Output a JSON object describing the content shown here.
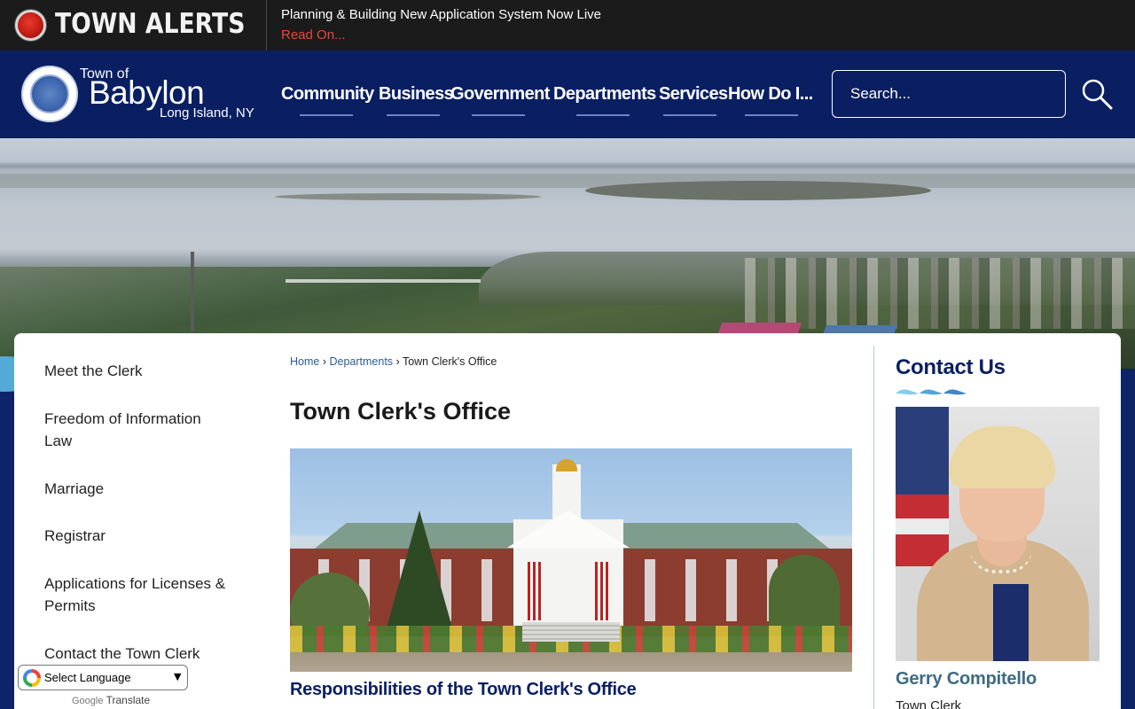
{
  "alert": {
    "title": "TOWN ALERTS",
    "message": "Planning & Building New Application System Now Live",
    "link": "Read On..."
  },
  "logo": {
    "town": "Town of",
    "name": "Babylon",
    "location": "Long Island, NY"
  },
  "nav": {
    "items": [
      {
        "label": "Community"
      },
      {
        "label": "Business"
      },
      {
        "label": "Government"
      },
      {
        "label": "Departments"
      },
      {
        "label": "Services"
      },
      {
        "label": "How Do I..."
      }
    ]
  },
  "search": {
    "placeholder": "Search..."
  },
  "sidebar": {
    "items": [
      {
        "label": "Meet the Clerk"
      },
      {
        "label": "Freedom of Information Law"
      },
      {
        "label": "Marriage"
      },
      {
        "label": "Registrar"
      },
      {
        "label": "Applications for Licenses & Permits"
      },
      {
        "label": "Contact the Town Clerk"
      }
    ]
  },
  "breadcrumb": {
    "home": "Home",
    "sep": "›",
    "departments": "Departments",
    "current": "Town Clerk's Office"
  },
  "main": {
    "title": "Town Clerk's Office",
    "subheading": "Responsibilities of the Town Clerk's Office"
  },
  "contact": {
    "title": "Contact Us",
    "name": "Gerry Compitello",
    "role": "Town Clerk"
  },
  "translate": {
    "label": "Select Language",
    "powered_prefix": "Google",
    "powered_suffix": "Translate"
  },
  "colors": {
    "navy": "#0a1f62",
    "alert_red": "#e8473c",
    "link_blue": "#2b5d9a",
    "wave_blue": "#54a9d6"
  }
}
